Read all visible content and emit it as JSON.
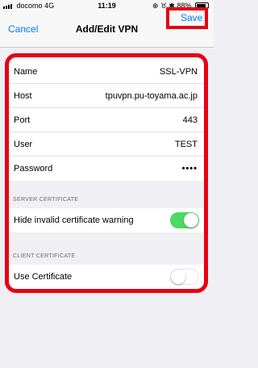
{
  "status_bar": {
    "carrier": "docomo",
    "network": "4G",
    "time": "11:19",
    "indicators": "⊕ ♉ ✱ 88%",
    "battery_level_percent": 88
  },
  "nav": {
    "cancel_label": "Cancel",
    "title": "Add/Edit VPN",
    "save_label": "Save",
    "accent_color": "#007aff",
    "highlight_color": "#e60012"
  },
  "connection": {
    "rows": [
      {
        "label": "Name",
        "value": "SSL-VPN"
      },
      {
        "label": "Host",
        "value": "tpuvpn.pu-toyama.ac.jp"
      },
      {
        "label": "Port",
        "value": "443"
      },
      {
        "label": "User",
        "value": "TEST"
      },
      {
        "label": "Password",
        "value": "••••"
      }
    ]
  },
  "server_certificate": {
    "header": "SERVER CERTIFICATE",
    "hide_warning_label": "Hide invalid certificate warning",
    "hide_warning_enabled": true
  },
  "client_certificate": {
    "header": "CLIENT CERTIFICATE",
    "use_certificate_label": "Use Certificate",
    "use_certificate_enabled": false
  },
  "toggle_on_color": "#4cd964"
}
